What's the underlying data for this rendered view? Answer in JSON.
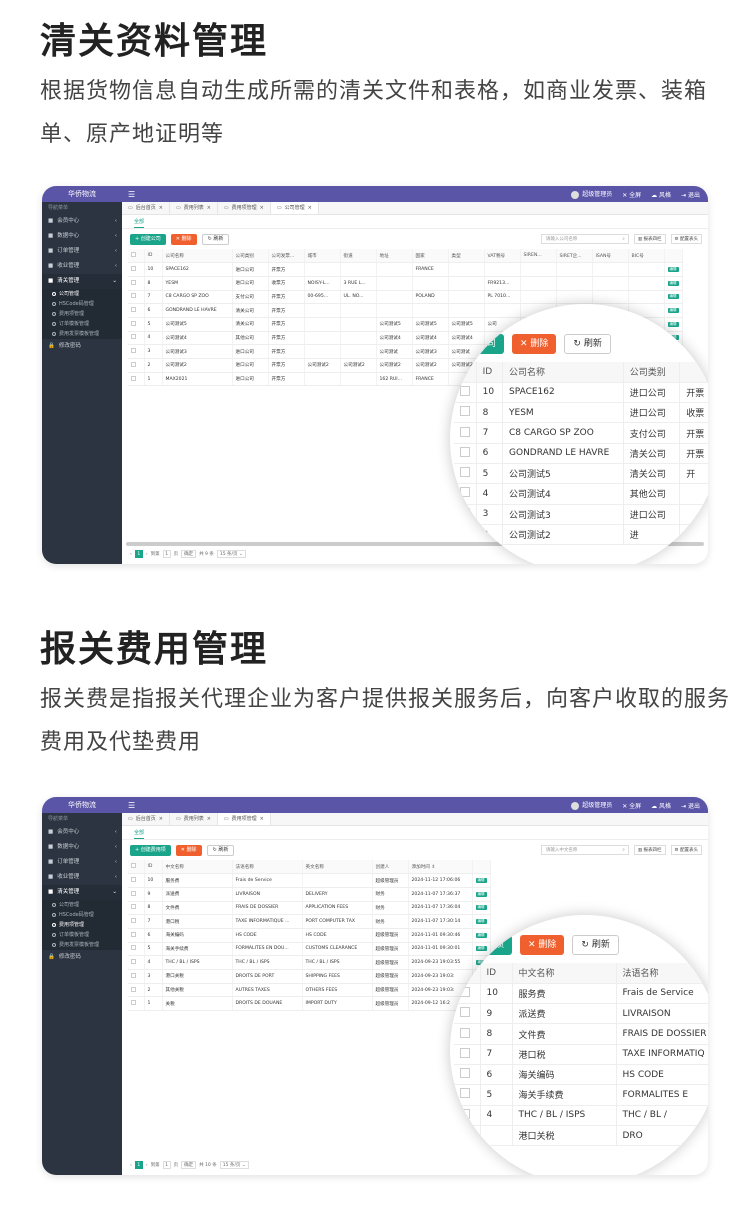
{
  "section1": {
    "title": "清关资料管理",
    "desc": "根据货物信息自动生成所需的清关文件和表格，如商业发票、装箱单、原产地证明等"
  },
  "section2": {
    "title": "报关费用管理",
    "desc": "报关费是指报关代理企业为客户提供报关服务后，向客户收取的服务费用及代垫费用"
  },
  "app": {
    "brand": "华侨物流",
    "menu_icon": "☰",
    "user": "超级管理员",
    "fullscreen": "全屏",
    "style": "风格",
    "exit": "退出"
  },
  "sidebar": {
    "header": "导航菜单",
    "items": [
      {
        "label": "会员中心",
        "icon": "users-icon"
      },
      {
        "label": "数据中心",
        "icon": "share-icon"
      },
      {
        "label": "订单管理",
        "icon": "list-icon"
      },
      {
        "label": "收业管理",
        "icon": "list-icon"
      },
      {
        "label": "清关管理",
        "icon": "doc-icon"
      }
    ],
    "subitems": [
      "公司管理",
      "HSCode码管理",
      "费用项管理",
      "订单模板管理",
      "费用发票模板管理"
    ],
    "last": "修改密码"
  },
  "screen1": {
    "tabs": [
      "后台首页",
      "费用列表",
      "费用项管理",
      "公司管理"
    ],
    "subtab": "全部",
    "add_btn": "创建公司",
    "del_btn": "删除",
    "refresh_btn": "刷新",
    "search_placeholder": "请输入公司名称",
    "tool1": "报表四栏",
    "tool2": "配置表头",
    "headers": [
      "ID",
      "公司名称",
      "公司类别",
      "公司发票...",
      "城市",
      "街道",
      "地址",
      "国家",
      "类型",
      "VAT税号",
      "SIREN...",
      "SIRET企...",
      "ISAN号",
      "BIC号"
    ],
    "rows": [
      [
        "10",
        "SPACE162",
        "进口公司",
        "开票方",
        "",
        "",
        "",
        "FRANCE",
        "",
        "",
        "",
        "",
        "",
        ""
      ],
      [
        "8",
        "YESM",
        "进口公司",
        "收票方",
        "NOISY-L...",
        "3 RUE L...",
        "",
        "",
        "",
        "FR9213...",
        "",
        "",
        "",
        ""
      ],
      [
        "7",
        "C8 CARGO SP ZOO",
        "支付公司",
        "开票方",
        "00-695...",
        "UL. NO...",
        "",
        "POLAND",
        "",
        "PL 7010...",
        "",
        "",
        "",
        ""
      ],
      [
        "6",
        "GONDRAND LE HAVRE",
        "清关公司",
        "开票方",
        "",
        "",
        "",
        "",
        "",
        "",
        "",
        "",
        "",
        ""
      ],
      [
        "5",
        "公司测试5",
        "清关公司",
        "开票方",
        "",
        "",
        "公司测试5",
        "公司测试5",
        "公司测试5",
        "公司",
        "",
        "",
        "",
        ""
      ],
      [
        "4",
        "公司测试4",
        "其他公司",
        "开票方",
        "",
        "",
        "公司测试4",
        "公司测试4",
        "公司测试4",
        "",
        "",
        "",
        "",
        ""
      ],
      [
        "3",
        "公司测试3",
        "进口公司",
        "开票方",
        "",
        "",
        "公司测试",
        "公司测试3",
        "公司测试",
        "",
        "",
        "",
        "",
        ""
      ],
      [
        "2",
        "公司测试2",
        "进口公司",
        "开票方",
        "公司测试2",
        "公司测试2",
        "公司测试2",
        "公司测试2",
        "公司测试2",
        "",
        "",
        "",
        "",
        ""
      ],
      [
        "1",
        "MAX2021",
        "进口公司",
        "开票方",
        "",
        "",
        "162 RUI...",
        "FRANCE",
        "",
        "",
        "",
        "",
        "",
        ""
      ]
    ],
    "edit_label": "编辑",
    "pager": {
      "page": "1",
      "goto": "到第",
      "page_unit": "页",
      "confirm": "确定",
      "total": "共 9 条",
      "size": "15 条/页"
    },
    "zoom": {
      "add_btn": "公司",
      "del_btn": "删除",
      "refresh_btn": "刷新",
      "headers": [
        "ID",
        "公司名称",
        "公司类别"
      ],
      "rows": [
        [
          "10",
          "SPACE162",
          "进口公司",
          "开票"
        ],
        [
          "8",
          "YESM",
          "进口公司",
          "收票"
        ],
        [
          "7",
          "C8 CARGO SP ZOO",
          "支付公司",
          "开票"
        ],
        [
          "6",
          "GONDRAND LE HAVRE",
          "清关公司",
          "开票"
        ],
        [
          "5",
          "公司测试5",
          "清关公司",
          "开"
        ],
        [
          "4",
          "公司测试4",
          "其他公司",
          ""
        ],
        [
          "3",
          "公司测试3",
          "进口公司",
          ""
        ],
        [
          "2",
          "公司测试2",
          "进",
          ""
        ]
      ]
    }
  },
  "screen2": {
    "tabs": [
      "后台首页",
      "费用列表",
      "费用项管理"
    ],
    "subtab": "全部",
    "add_btn": "创建费用项",
    "del_btn": "删除",
    "refresh_btn": "刷新",
    "search_placeholder": "请输入中文名称",
    "tool1": "报表四栏",
    "tool2": "配置表头",
    "headers": [
      "ID",
      "中文名称",
      "法语名称",
      "英文名称",
      "创建人",
      "添加时间 ⇕"
    ],
    "rows": [
      [
        "10",
        "服务费",
        "Frais de Service",
        "",
        "超级管理员",
        "2024-11-12 17:06:06"
      ],
      [
        "9",
        "派送费",
        "LIVRAISON",
        "DELIVERY",
        "财务",
        "2024-11-07 17:36:37"
      ],
      [
        "8",
        "文件费",
        "FRAIS DE DOSSIER",
        "APPLICATION FEES",
        "财务",
        "2024-11-07 17:36:04"
      ],
      [
        "7",
        "港口税",
        "TAXE INFORMATIQUE ...",
        "PORT COMPUTER TAX",
        "财务",
        "2024-11-07 17:30:14"
      ],
      [
        "6",
        "海关编码",
        "HS CODE",
        "HS CODE",
        "超级管理员",
        "2024-11-01 09:30:46"
      ],
      [
        "5",
        "海关手续费",
        "FORMALITES EN DOU...",
        "CUSTOMS CLEARANCE",
        "超级管理员",
        "2024-11-01 09:30:01"
      ],
      [
        "4",
        "THC / BL / ISPS",
        "THC / BL / ISPS",
        "THC / BL / ISPS",
        "超级管理员",
        "2024-09-23 19:03:55"
      ],
      [
        "3",
        "港口关税",
        "DROITS DE PORT",
        "SHIPPING FEES",
        "超级管理员",
        "2024-09-23 19:03:"
      ],
      [
        "2",
        "其他关税",
        "AUTRES TAXES",
        "OTHERS FEES",
        "超级管理员",
        "2024-09-23 19:03:"
      ],
      [
        "1",
        "关税",
        "DROITS DE DOUANE",
        "IMPORT DUTY",
        "超级管理员",
        "2024-09-12 16:2"
      ]
    ],
    "edit_label": "编辑",
    "pager": {
      "page": "1",
      "goto": "到第",
      "page_unit": "页",
      "confirm": "确定",
      "total": "共 10 条",
      "size": "15 条/页"
    },
    "zoom": {
      "add_btn": "用项",
      "del_btn": "删除",
      "refresh_btn": "刷新",
      "headers": [
        "ID",
        "中文名称",
        "法语名称"
      ],
      "rows": [
        [
          "10",
          "服务费",
          "Frais de Service"
        ],
        [
          "9",
          "派送费",
          "LIVRAISON"
        ],
        [
          "8",
          "文件费",
          "FRAIS DE DOSSIER"
        ],
        [
          "7",
          "港口税",
          "TAXE INFORMATIQ"
        ],
        [
          "6",
          "海关编码",
          "HS CODE"
        ],
        [
          "5",
          "海关手续费",
          "FORMALITES E"
        ],
        [
          "4",
          "THC / BL / ISPS",
          "THC / BL /"
        ],
        [
          "",
          "港口关税",
          "DRO"
        ]
      ]
    }
  }
}
